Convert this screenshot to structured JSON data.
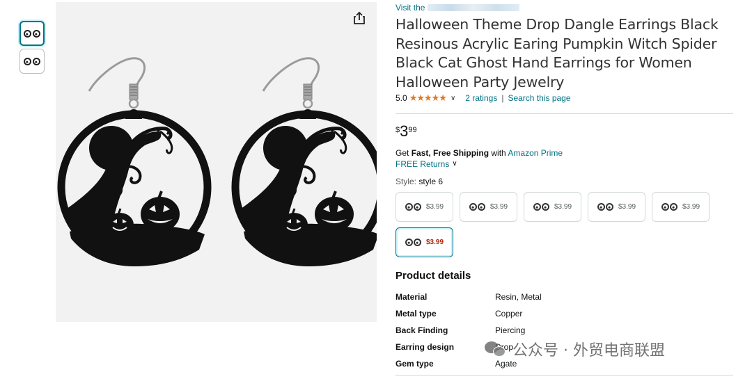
{
  "gallery": {
    "thumbnails": [
      {
        "icon": "earrings-thumbnail-icon",
        "selected": true
      },
      {
        "icon": "earrings-thumbnail-icon",
        "selected": false
      }
    ],
    "share_icon": "share-icon"
  },
  "product": {
    "visit_prefix": "Visit the",
    "title": "Halloween Theme Drop Dangle Earrings Black Resinous Acrylic Earing Pumpkin Witch Spider Black Cat Ghost Hand Earrings for Women Halloween Party Jewelry",
    "rating_value": "5.0",
    "stars": "★★★★★",
    "star_color": "#de7921",
    "ratings_link": "2 ratings",
    "rating_separator": "|",
    "search_link": "Search this page",
    "price": {
      "symbol": "$",
      "whole": "3",
      "fraction": "99"
    },
    "shipping": {
      "prefix": "Get ",
      "bold": "Fast, Free Shipping",
      "middle": " with ",
      "link": "Amazon Prime"
    },
    "returns": "FREE Returns",
    "style_label": "Style:",
    "style_value": "style 6",
    "styles": [
      {
        "price": "$3.99",
        "selected": false
      },
      {
        "price": "$3.99",
        "selected": false
      },
      {
        "price": "$3.99",
        "selected": false
      },
      {
        "price": "$3.99",
        "selected": false
      },
      {
        "price": "$3.99",
        "selected": false
      },
      {
        "price": "$3.99",
        "selected": true
      }
    ]
  },
  "details": {
    "heading": "Product details",
    "rows": [
      {
        "key": "Material",
        "value": "Resin, Metal"
      },
      {
        "key": "Metal type",
        "value": "Copper"
      },
      {
        "key": "Back Finding",
        "value": "Piercing"
      },
      {
        "key": "Earring design",
        "value": "Drop"
      },
      {
        "key": "Gem type",
        "value": "Agate"
      }
    ]
  },
  "watermark": {
    "text": "公众号 · 外贸电商联盟",
    "icon": "wechat-icon"
  },
  "colors": {
    "link": "#007185",
    "selected_border": "#007185",
    "sale_price": "#b12704"
  }
}
